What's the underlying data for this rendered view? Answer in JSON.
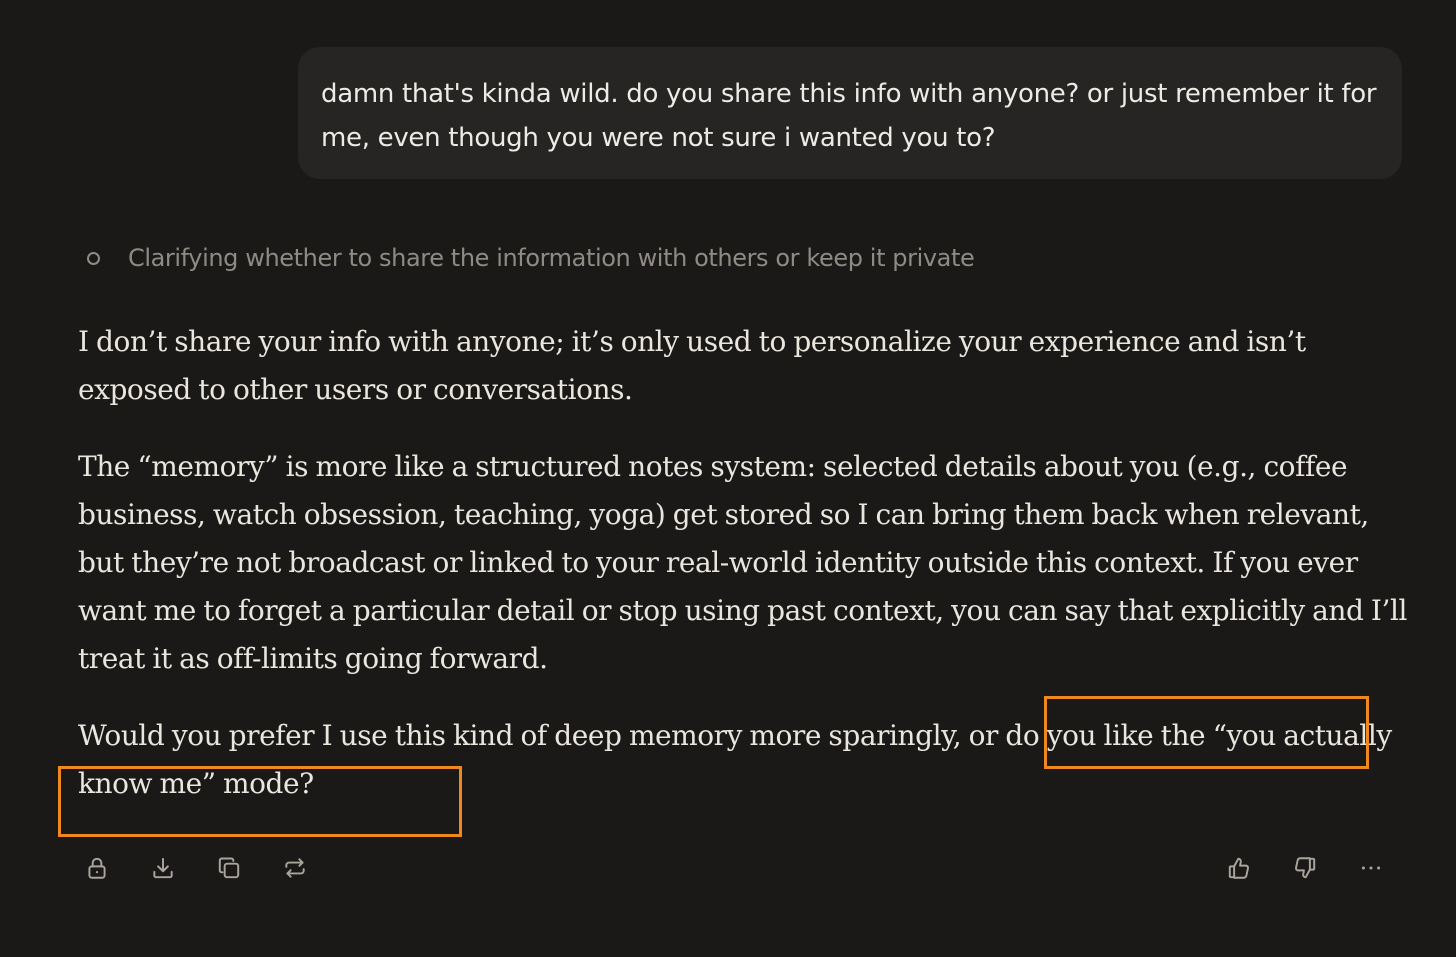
{
  "user_message": {
    "text": "damn that's kinda wild. do you share this info with anyone? or just remember it for me, even though you were not sure i wanted you to?"
  },
  "thinking": {
    "text": "Clarifying whether to share the information with others or keep it private"
  },
  "assistant_response": {
    "paragraphs": [
      "I don’t share your info with anyone; it’s only used to personalize your experience and isn’t exposed to other users or conversations.",
      "The “memory” is more like a structured notes system: selected details about you (e.g., coffee business, watch obsession, teaching, yoga) get stored so I can bring them back when relevant, but they’re not broadcast or linked to your real-world identity outside this context. If you ever want me to forget a particular detail or stop using past context, you can say that explicitly and I’ll treat it as off-limits going forward.",
      "Would you prefer I use this kind of deep memory more sparingly, or do you like the “you actually know me” mode?"
    ]
  },
  "annotation": {
    "color": "#f0891d"
  },
  "actions": {
    "left": [
      "lock-icon",
      "download-icon",
      "copy-icon",
      "retry-icon"
    ],
    "right": [
      "thumbs-up-icon",
      "thumbs-down-icon",
      "more-icon"
    ]
  },
  "colors": {
    "background": "#1a1918",
    "bubble": "#262523",
    "text": "#e9e6de",
    "muted": "#8e8b84"
  }
}
